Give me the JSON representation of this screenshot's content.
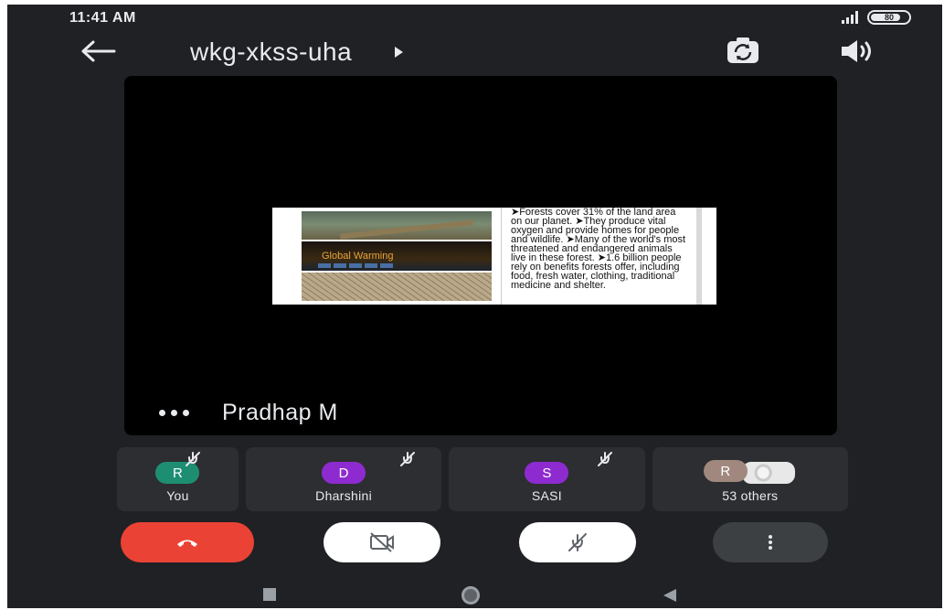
{
  "status_bar": {
    "time": "11:41 AM",
    "battery": "80"
  },
  "header": {
    "meeting_code": "wkg-xkss-uha"
  },
  "main_tile": {
    "presenter_name": "Pradhap M",
    "slide": {
      "image_caption": "Global Warming",
      "text": "➤Forests cover 31% of the land area on our planet. ➤They produce vital oxygen and provide homes for people and wildlife. ➤Many of the world's most threatened and endangered animals live in these forest. ➤1.6 billion people rely on benefits forests offer, including food, fresh water, clothing, traditional medicine and shelter."
    }
  },
  "participants": [
    {
      "initial": "R",
      "name": "You",
      "color": "#1e8e73"
    },
    {
      "initial": "D",
      "name": "Dharshini",
      "color": "#8e2bd0"
    },
    {
      "initial": "S",
      "name": "SASI",
      "color": "#8e2bd0"
    },
    {
      "initial": "R",
      "name": "53 others",
      "color": "#a1887f"
    }
  ],
  "icons": {
    "back": "arrow-left-icon",
    "switch_camera": "switch-camera-icon",
    "speaker": "speaker-icon",
    "end_call": "phone-hangup-icon",
    "camera_off": "camera-off-icon",
    "mic_off": "mic-off-icon",
    "more": "more-vert-icon"
  },
  "colors": {
    "end_call": "#ea4335",
    "background": "#202124",
    "tile": "#2d2e31"
  }
}
